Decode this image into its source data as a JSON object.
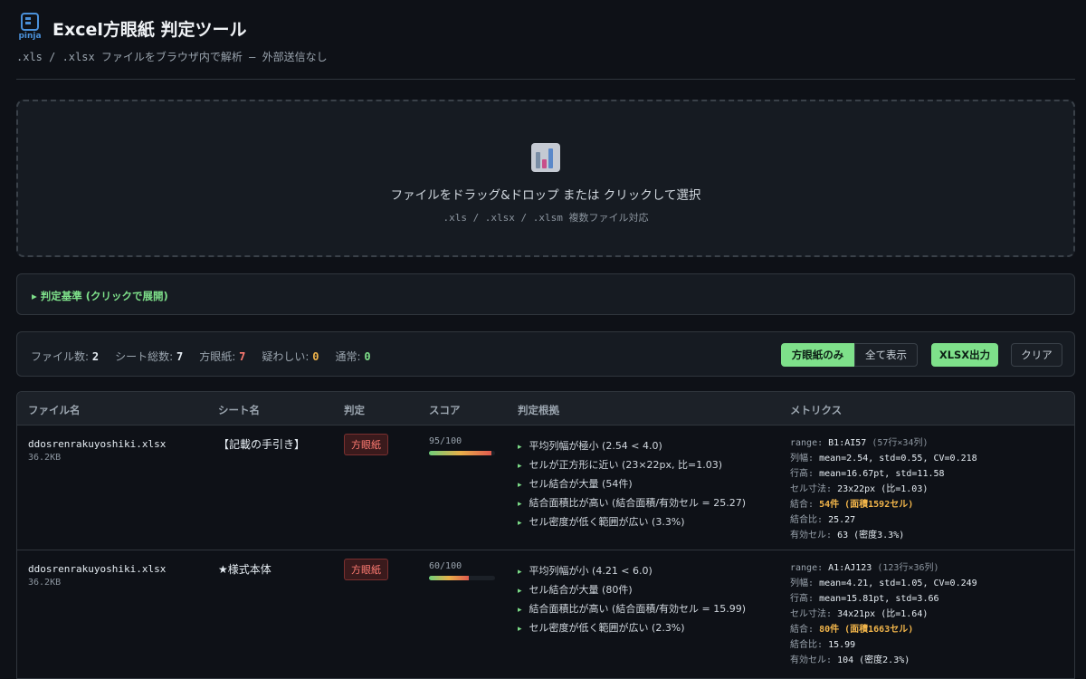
{
  "app": {
    "logo_text": "pinja",
    "title": "Excel方眼紙 判定ツール",
    "subtitle": ".xls / .xlsx ファイルをブラウザ内で解析 — 外部送信なし"
  },
  "dropzone": {
    "title": "ファイルをドラッグ&ドロップ または クリックして選択",
    "subtitle": ".xls / .xlsx / .xlsm 複数ファイル対応"
  },
  "criteria": {
    "label": "▸ 判定基準 (クリックで展開)"
  },
  "summary": {
    "files_label": "ファイル数:",
    "files_value": "2",
    "sheets_label": "シート総数:",
    "sheets_value": "7",
    "hougan_label": "方眼紙:",
    "hougan_value": "7",
    "suspicious_label": "疑わしい:",
    "suspicious_value": "0",
    "normal_label": "通常:",
    "normal_value": "0",
    "colors": {
      "files": "#e6edf3",
      "hougan": "#ff7b72",
      "suspicious": "#f0b44a",
      "normal": "#7ee08a"
    }
  },
  "toolbar": {
    "only_hougan": "方眼紙のみ",
    "show_all": "全て表示",
    "export": "XLSX出力",
    "clear": "クリア"
  },
  "table": {
    "headers": {
      "file": "ファイル名",
      "sheet": "シート名",
      "verdict": "判定",
      "score": "スコア",
      "reason": "判定根拠",
      "metrics": "メトリクス"
    },
    "rows": [
      {
        "file": "ddosrenrakuyoshiki.xlsx",
        "size": "36.2KB",
        "sheet": "【記載の手引き】",
        "verdict": "方眼紙",
        "score_text": "95/100",
        "score": 95,
        "reasons": [
          "平均列幅が極小 (2.54 < 4.0)",
          "セルが正方形に近い (23×22px, 比=1.03)",
          "セル結合が大量 (54件)",
          "結合面積比が高い (結合面積/有効セル = 25.27)",
          "セル密度が低く範囲が広い (3.3%)"
        ],
        "m_range_k": "range:",
        "m_range_v": "B1:AI57",
        "m_range_note": "(57行×34列)",
        "m_colw_k": "列幅:",
        "m_colw_v": "mean=2.54, std=0.55, CV=0.218",
        "m_rowh_k": "行高:",
        "m_rowh_v": "mean=16.67pt, std=11.58",
        "m_cell_k": "セル寸法:",
        "m_cell_v": "23x22px (比=1.03)",
        "m_merge_k": "結合:",
        "m_merge_v": "54件 (面積1592セル)",
        "m_ratio_k": "結合比:",
        "m_ratio_v": "25.27",
        "m_eff_k": "有効セル:",
        "m_eff_v": "63 (密度3.3%)"
      },
      {
        "file": "ddosrenrakuyoshiki.xlsx",
        "size": "36.2KB",
        "sheet": "★様式本体",
        "verdict": "方眼紙",
        "score_text": "60/100",
        "score": 60,
        "reasons": [
          "平均列幅が小 (4.21 < 6.0)",
          "セル結合が大量 (80件)",
          "結合面積比が高い (結合面積/有効セル = 15.99)",
          "セル密度が低く範囲が広い (2.3%)"
        ],
        "m_range_k": "range:",
        "m_range_v": "A1:AJ123",
        "m_range_note": "(123行×36列)",
        "m_colw_k": "列幅:",
        "m_colw_v": "mean=4.21, std=1.05, CV=0.249",
        "m_rowh_k": "行高:",
        "m_rowh_v": "mean=15.81pt, std=3.66",
        "m_cell_k": "セル寸法:",
        "m_cell_v": "34x21px (比=1.64)",
        "m_merge_k": "結合:",
        "m_merge_v": "80件 (面積1663セル)",
        "m_ratio_k": "結合比:",
        "m_ratio_v": "15.99",
        "m_eff_k": "有効セル:",
        "m_eff_v": "104 (密度2.3%)"
      }
    ]
  }
}
